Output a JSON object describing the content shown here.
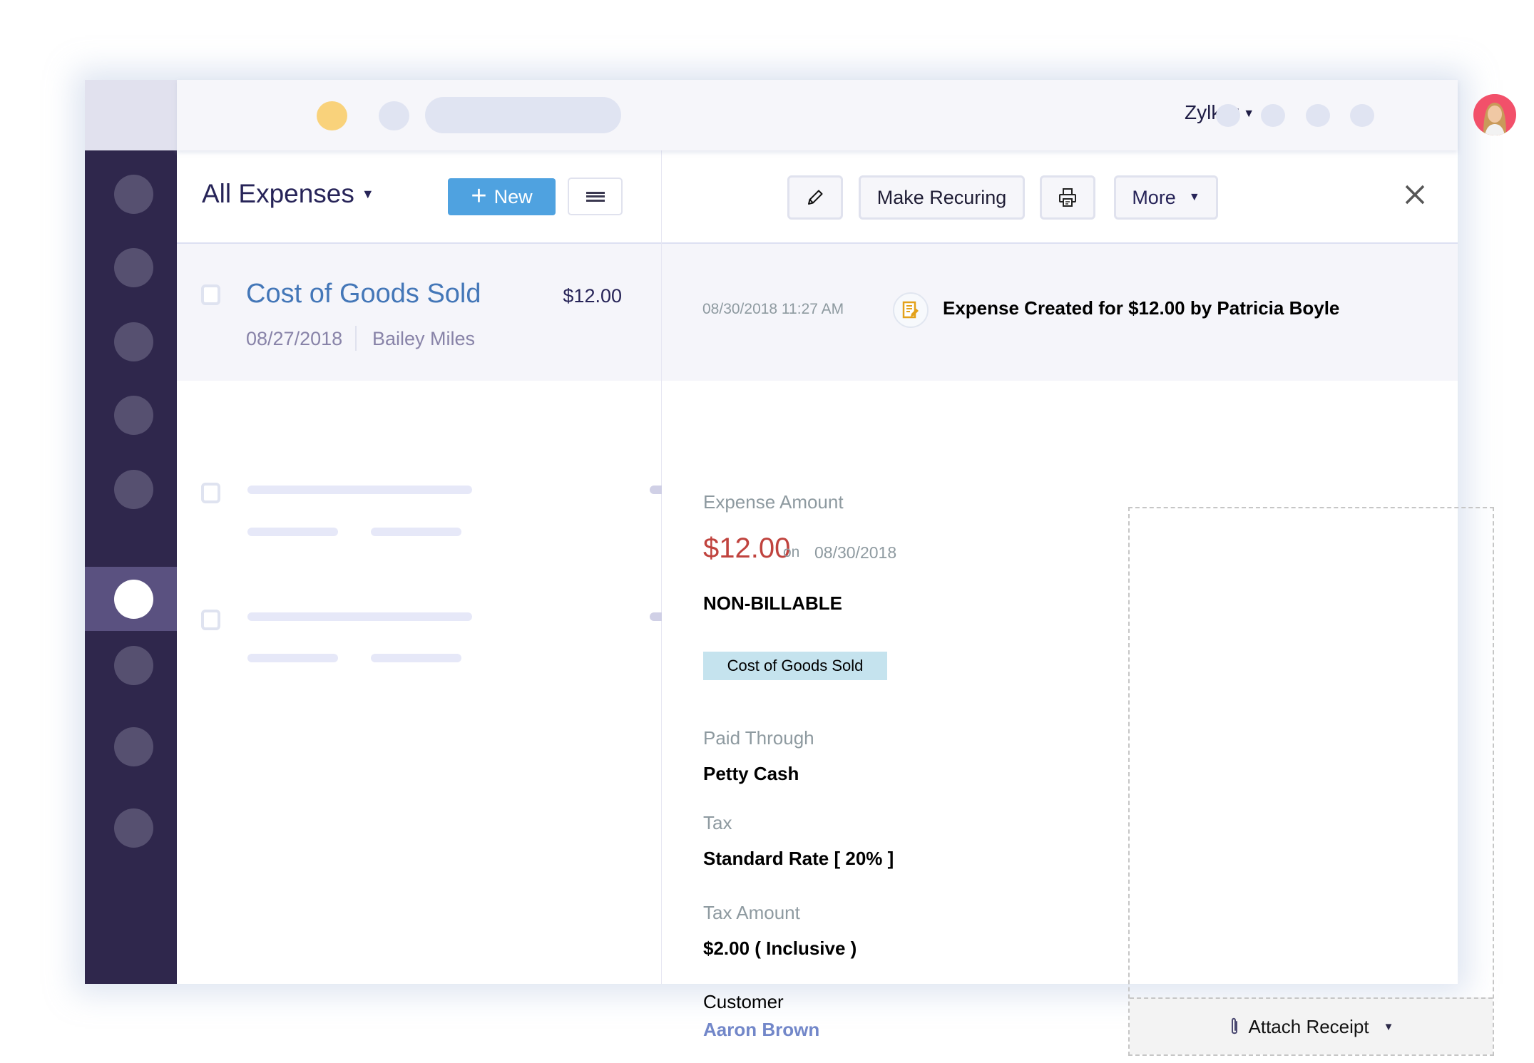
{
  "header": {
    "org_name": "Zylker",
    "org_caret": "▼",
    "avatar_alt": "user avatar"
  },
  "sidebar": {
    "items": [
      {
        "name": "nav-item-1",
        "active": false
      },
      {
        "name": "nav-item-2",
        "active": false
      },
      {
        "name": "nav-item-3",
        "active": false
      },
      {
        "name": "nav-item-4",
        "active": false
      },
      {
        "name": "nav-item-5",
        "active": false
      },
      {
        "name": "nav-item-6",
        "active": true
      },
      {
        "name": "nav-item-7",
        "active": false
      },
      {
        "name": "nav-item-8",
        "active": false
      },
      {
        "name": "nav-item-9",
        "active": false
      }
    ]
  },
  "list": {
    "view_title": "All Expenses",
    "view_caret": "▼",
    "new_button": {
      "icon": "+",
      "label": "New"
    },
    "menu_icon": "hamburger-icon",
    "selected_row": {
      "title": "Cost of Goods Sold",
      "amount": "$12.00",
      "date": "08/27/2018",
      "person": "Bailey Miles"
    }
  },
  "toolbar": {
    "edit_icon": "pencil-icon",
    "make_recurring_label": "Make Recuring",
    "print_icon": "printer-icon",
    "more_label": "More",
    "more_caret": "▼",
    "close_icon": "close-icon"
  },
  "activity": {
    "timestamp": "08/30/2018 11:27 AM",
    "icon": "document-edit-icon",
    "text": "Expense Created for $12.00 by Patricia Boyle"
  },
  "details": {
    "expense_amount_label": "Expense Amount",
    "amount": "$12.00",
    "on_label": "on",
    "date": "08/30/2018",
    "billable_status": "NON-BILLABLE",
    "category_badge": "Cost of Goods Sold",
    "paid_through_label": "Paid Through",
    "paid_through": "Petty Cash",
    "tax_label": "Tax",
    "tax": "Standard Rate [ 20% ]",
    "tax_amount_label": "Tax Amount",
    "tax_amount": "$2.00 ( Inclusive )",
    "customer_label": "Customer",
    "customer": "Aaron Brown"
  },
  "receipt": {
    "attach_label": "Attach Receipt",
    "attach_caret": "▼",
    "attach_icon": "paperclip-icon"
  },
  "colors": {
    "sidebar": "#2f274c",
    "sidebar_active": "#5a5180",
    "primary_button": "#4fa2e0",
    "link": "#4477b8",
    "amount_red": "#c0433e",
    "badge_bg": "#c5e3ee",
    "customer_link": "#7287c9"
  }
}
